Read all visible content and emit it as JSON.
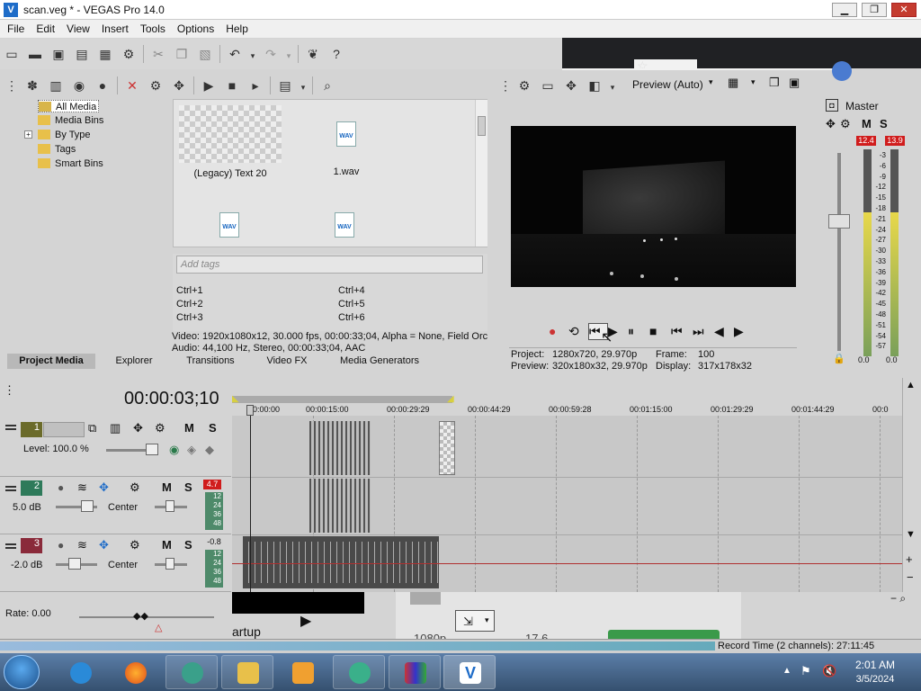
{
  "window": {
    "title": "scan.veg * - VEGAS Pro 14.0",
    "min": "▁",
    "max": "❐",
    "close": "✕"
  },
  "menu": [
    "File",
    "Edit",
    "View",
    "Insert",
    "Tools",
    "Options",
    "Help"
  ],
  "project_media": {
    "tree": [
      "All Media",
      "Media Bins",
      "By Type",
      "Tags",
      "Smart Bins"
    ],
    "expander": "+",
    "items": [
      {
        "label": "(Legacy) Text 20",
        "kind": "generator"
      },
      {
        "label": "1.wav",
        "kind": "wav"
      },
      {
        "label": "",
        "kind": "wav"
      },
      {
        "label": "",
        "kind": "wav"
      }
    ],
    "wav_badge": "WAV",
    "tags_placeholder": "Add tags",
    "shortcuts_left": [
      "Ctrl+1",
      "Ctrl+2",
      "Ctrl+3"
    ],
    "shortcuts_right": [
      "Ctrl+4",
      "Ctrl+5",
      "Ctrl+6"
    ],
    "info_video": "Video: 1920x1080x12, 30.000 fps, 00:00:33;04, Alpha = None, Field Orc",
    "info_audio": "Audio: 44,100 Hz, Stereo, 00:00:33;04, AAC",
    "tabs": [
      "Project Media",
      "Explorer",
      "Transitions",
      "Video FX",
      "Media Generators"
    ]
  },
  "preview": {
    "quality": "Preview (Auto)",
    "project_label": "Project:",
    "project_value": "1280x720, 29.970p",
    "frame_label": "Frame:",
    "frame_value": "100",
    "preview_label": "Preview:",
    "preview_value": "320x180x32, 29.970p",
    "display_label": "Display:",
    "display_value": "317x178x32"
  },
  "master": {
    "title": "Master",
    "peak_left": "12.4",
    "peak_right": "13.9",
    "scale": [
      "3",
      "6",
      "9",
      "12",
      "15",
      "18",
      "21",
      "24",
      "27",
      "30",
      "33",
      "36",
      "39",
      "42",
      "45",
      "48",
      "51",
      "54",
      "57"
    ],
    "vol_left": "0.0",
    "vol_right": "0.0",
    "mute": "M",
    "solo": "S"
  },
  "timeline": {
    "timecode": "00:00:03;10",
    "ruler": [
      "00:00:00",
      "00:00:15:00",
      "00:00:29:29",
      "00:00:44:29",
      "00:00:59:28",
      "00:01:15:00",
      "00:01:29:29",
      "00:01:44:29",
      "00:0"
    ],
    "tracks": [
      {
        "num": "1",
        "type": "video",
        "level": "Level: 100.0 %"
      },
      {
        "num": "2",
        "type": "audio",
        "vol": "5.0 dB",
        "pan": "Center",
        "peak": "4.7"
      },
      {
        "num": "3",
        "type": "audio",
        "vol": "-2.0 dB",
        "pan": "Center",
        "peak": "-0.8"
      }
    ],
    "meter_ticks": [
      "12",
      "24",
      "36",
      "48"
    ],
    "rate": "Rate: 0.00",
    "mute": "M",
    "solo": "S"
  },
  "background_text": {
    "a": "artup",
    "b": "1080p",
    "c": "17.6"
  },
  "status": {
    "record_time": "Record Time (2 channels): 27:11:45"
  },
  "taskbar": {
    "time": "2:01 AM",
    "date": "3/5/2024"
  },
  "colors": {
    "accent": "#1e6cc8",
    "track_video": "#6b6b2a",
    "track_audio": "#2e7a5a",
    "track_audio3": "#8a2a3a"
  }
}
